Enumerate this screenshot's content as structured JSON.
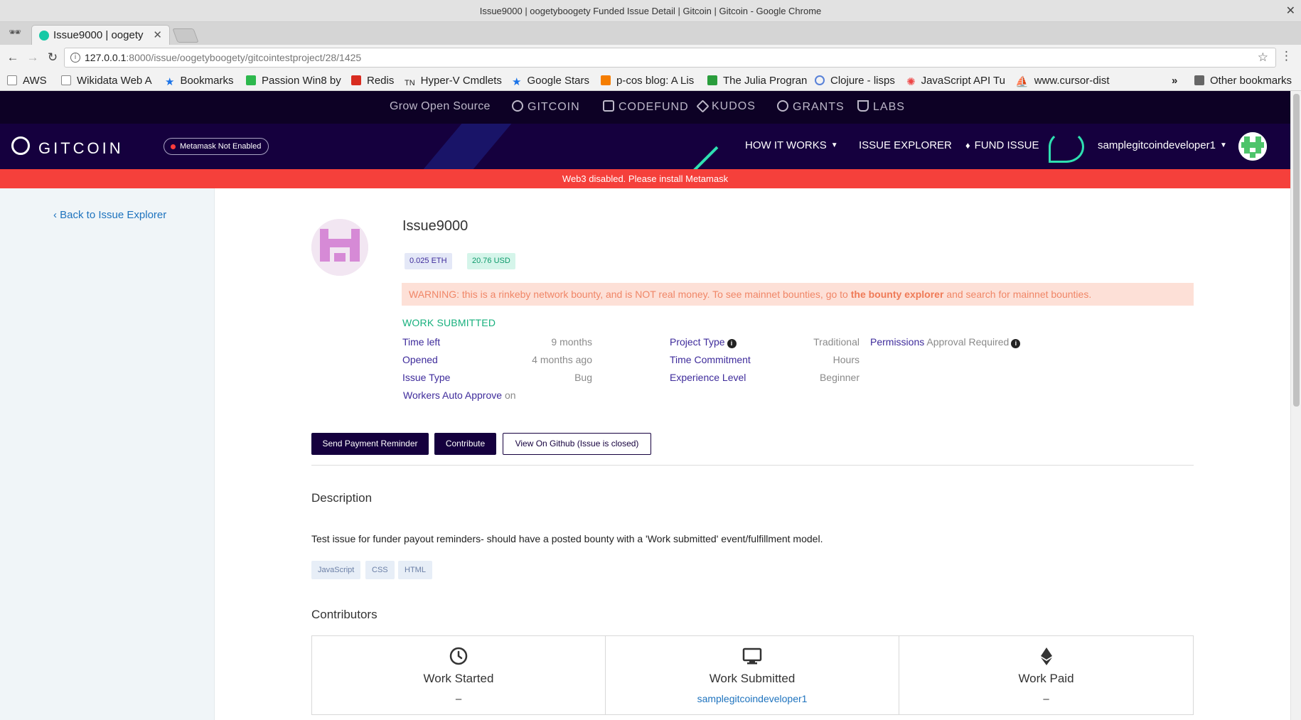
{
  "window": {
    "title": "Issue9000 | oogetyboogety Funded Issue Detail | Gitcoin | Gitcoin - Google Chrome",
    "tab_title": "Issue9000 | oogety",
    "url_host": "127.0.0.1",
    "url_path": ":8000/issue/oogetyboogety/gitcointestproject/28/1425"
  },
  "bookmarks": [
    {
      "label": "AWS",
      "icon": "page-icon",
      "color": "#ffffff"
    },
    {
      "label": "Wikidata Web A",
      "icon": "page-icon",
      "color": "#ffffff"
    },
    {
      "label": "Bookmarks",
      "icon": "star-icon",
      "color": "#1a73e8"
    },
    {
      "label": "Passion Win8 by",
      "icon": "leaf-icon",
      "color": "#2db84d"
    },
    {
      "label": "Redis",
      "icon": "redis-icon",
      "color": "#d82c20"
    },
    {
      "label": "Hyper-V Cmdlets",
      "icon": "tn-icon",
      "color": "#555555"
    },
    {
      "label": "Google Stars",
      "icon": "star-icon",
      "color": "#1a73e8"
    },
    {
      "label": "p-cos blog: A Lis",
      "icon": "blogger-icon",
      "color": "#f57d00"
    },
    {
      "label": "The Julia Progran",
      "icon": "np-icon",
      "color": "#2a9d3c"
    },
    {
      "label": "Clojure - lisps",
      "icon": "clojure-icon",
      "color": "#5881d8"
    },
    {
      "label": "JavaScript API Tu",
      "icon": "gear-icon",
      "color": "#e44"
    },
    {
      "label": "www.cursor-dist",
      "icon": "sail-icon",
      "color": "#3e3e9e"
    }
  ],
  "bookmarks_overflow": "»",
  "bookmarks_other": "Other bookmarks",
  "topnav": {
    "tagline": "Grow Open Source",
    "items": [
      "GITCOIN",
      "CODEFUND",
      "KUDOS",
      "GRANTS",
      "LABS"
    ]
  },
  "mainnav": {
    "logo_text": "GITCOIN",
    "metamask_badge": "Metamask Not Enabled",
    "how_it_works": "HOW IT WORKS",
    "issue_explorer": "ISSUE EXPLORER",
    "fund_issue": "FUND ISSUE",
    "username": "samplegitcoindeveloper1"
  },
  "web3_banner": "Web3 disabled. Please install Metamask",
  "back_link": "Back to Issue Explorer",
  "issue": {
    "title": "Issue9000",
    "eth_amount": "0.025 ETH",
    "usd_amount": "20.76 USD",
    "warning_prefix": "WARNING: this is a rinkeby network bounty, and is NOT real money. To see mainnet bounties, go to",
    "warning_link": "the bounty explorer",
    "warning_suffix": "and search for mainnet bounties.",
    "status": "WORK SUBMITTED",
    "time_left_label": "Time left",
    "time_left_value": "9 months",
    "opened_label": "Opened",
    "opened_value": "4 months ago",
    "issue_type_label": "Issue Type",
    "issue_type_value": "Bug",
    "workers_auto_approve_label": "Workers Auto Approve",
    "workers_auto_approve_value": "on",
    "project_type_label": "Project Type",
    "project_type_value": "Traditional",
    "time_commitment_label": "Time Commitment",
    "time_commitment_value": "Hours",
    "experience_level_label": "Experience Level",
    "experience_level_value": "Beginner",
    "permissions_label": "Permissions",
    "permissions_value": "Approval Required"
  },
  "buttons": {
    "send_payment_reminder": "Send Payment Reminder",
    "contribute": "Contribute",
    "view_on_github": "View On Github (Issue is closed)"
  },
  "description": {
    "heading": "Description",
    "text": "Test issue for funder payout reminders- should have a posted bounty with a 'Work submitted' event/fulfillment model.",
    "tags": [
      "JavaScript",
      "CSS",
      "HTML"
    ]
  },
  "contributors": {
    "heading": "Contributors",
    "columns": [
      {
        "label": "Work Started",
        "value": "–",
        "icon": "clock-icon"
      },
      {
        "label": "Work Submitted",
        "value": "samplegitcoindeveloper1",
        "icon": "monitor-icon"
      },
      {
        "label": "Work Paid",
        "value": "–",
        "icon": "ethereum-icon"
      }
    ]
  },
  "colors": {
    "brand_dark": "#15003e",
    "banner_red": "#f5403b",
    "status_green": "#17b07d",
    "link_blue": "#1e73be"
  }
}
